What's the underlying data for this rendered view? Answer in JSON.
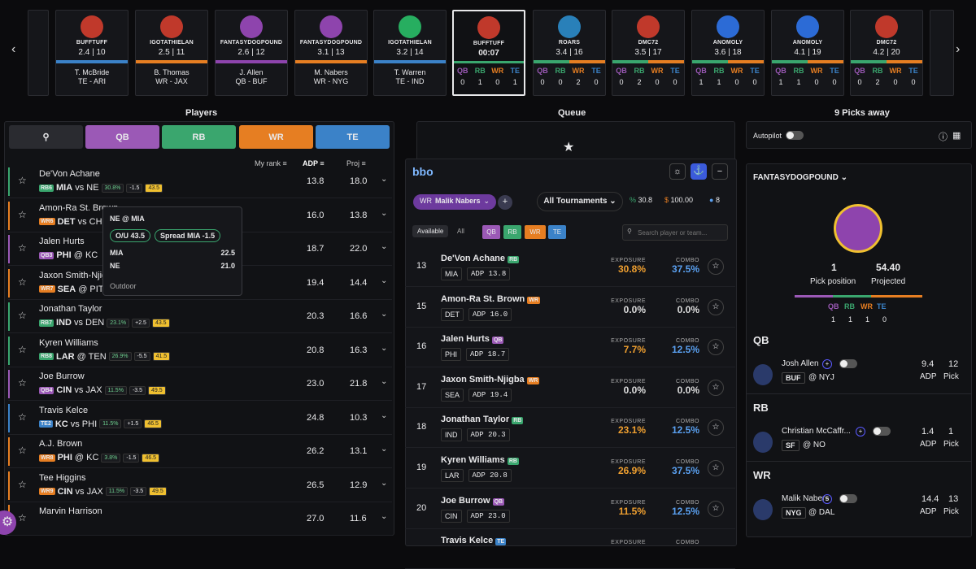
{
  "draft": {
    "cards": [
      {
        "name": "BUFFTUFF",
        "round": "2.4",
        "pick": "10",
        "player": "T. McBride",
        "team": "TE - ARI",
        "stripe": "#3b82c8",
        "av": "#c0392b"
      },
      {
        "name": "IGOTATHIELAN",
        "round": "2.5",
        "pick": "11",
        "player": "B. Thomas",
        "team": "WR - JAX",
        "stripe": "#e67e22",
        "av": "#c0392b"
      },
      {
        "name": "FANTASYDOGPOUND",
        "round": "2.6",
        "pick": "12",
        "player": "J. Allen",
        "team": "QB - BUF",
        "stripe": "#8e44ad",
        "av": "#8e44ad"
      },
      {
        "name": "FANTASYDOGPOUND",
        "round": "3.1",
        "pick": "13",
        "player": "M. Nabers",
        "team": "WR - NYG",
        "stripe": "#e67e22",
        "av": "#8e44ad"
      },
      {
        "name": "IGOTATHIELAN",
        "round": "3.2",
        "pick": "14",
        "player": "T. Warren",
        "team": "TE - IND",
        "stripe": "#3b82c8",
        "av": "#27ae60"
      }
    ],
    "current": {
      "name": "BUFFTUFF",
      "timer": "00:07",
      "counts": [
        "0",
        "1",
        "0",
        "1"
      ]
    },
    "future": [
      {
        "name": "ROARS",
        "round": "3.4",
        "pick": "16",
        "counts": [
          "0",
          "0",
          "2",
          "0"
        ],
        "av": "#2980b9"
      },
      {
        "name": "DMC72",
        "round": "3.5",
        "pick": "17",
        "counts": [
          "0",
          "2",
          "0",
          "0"
        ],
        "av": "#c0392b"
      },
      {
        "name": "ANOMOLY",
        "round": "3.6",
        "pick": "18",
        "counts": [
          "1",
          "1",
          "0",
          "0"
        ],
        "av": "#2c6bd6"
      },
      {
        "name": "ANOMOLY",
        "round": "4.1",
        "pick": "19",
        "counts": [
          "1",
          "1",
          "0",
          "0"
        ],
        "av": "#2c6bd6"
      },
      {
        "name": "DMC72",
        "round": "4.2",
        "pick": "20",
        "counts": [
          "0",
          "2",
          "0",
          "0"
        ],
        "av": "#c0392b"
      }
    ],
    "pos_labels": [
      "QB",
      "RB",
      "WR",
      "TE"
    ]
  },
  "sections": {
    "players": "Players",
    "queue": "Queue",
    "picks_away": "9 Picks away"
  },
  "player_tabs": {
    "qb": "QB",
    "rb": "RB",
    "wr": "WR",
    "te": "TE"
  },
  "columns": {
    "my_rank": "My rank",
    "adp": "ADP",
    "proj": "Proj"
  },
  "players": [
    {
      "name": "De'Von Achane",
      "pos": "RB6",
      "posc": "#3aa66e",
      "team": "MIA",
      "opp": "vs NE",
      "pct": "30.8%",
      "sp": "-1.5",
      "ou": "43.5",
      "adp": "13.8",
      "proj": "18.0"
    },
    {
      "name": "Amon-Ra St. Brown",
      "pos": "WR6",
      "posc": "#e67e22",
      "team": "DET",
      "opp": "vs CHI",
      "pct": "",
      "sp": "",
      "ou": "",
      "adp": "16.0",
      "proj": "13.8"
    },
    {
      "name": "Jalen Hurts",
      "pos": "QB3",
      "posc": "#9b59b6",
      "team": "PHI",
      "opp": "@ KC",
      "pct": "",
      "sp": "",
      "ou": "",
      "adp": "18.7",
      "proj": "22.0"
    },
    {
      "name": "Jaxon Smith-Njigba",
      "pos": "WR7",
      "posc": "#e67e22",
      "team": "SEA",
      "opp": "@ PIT",
      "pct": "",
      "sp": "",
      "ou": "",
      "adp": "19.4",
      "proj": "14.4"
    },
    {
      "name": "Jonathan Taylor",
      "pos": "RB7",
      "posc": "#3aa66e",
      "team": "IND",
      "opp": "vs DEN",
      "pct": "23.1%",
      "sp": "+2.5",
      "ou": "43.5",
      "adp": "20.3",
      "proj": "16.6"
    },
    {
      "name": "Kyren Williams",
      "pos": "RB8",
      "posc": "#3aa66e",
      "team": "LAR",
      "opp": "@ TEN",
      "pct": "26.9%",
      "sp": "-5.5",
      "ou": "41.5",
      "adp": "20.8",
      "proj": "16.3"
    },
    {
      "name": "Joe Burrow",
      "pos": "QB4",
      "posc": "#9b59b6",
      "team": "CIN",
      "opp": "vs JAX",
      "pct": "11.5%",
      "sp": "-3.5",
      "ou": "49.5",
      "adp": "23.0",
      "proj": "21.8"
    },
    {
      "name": "Travis Kelce",
      "pos": "TE2",
      "posc": "#3b82c8",
      "team": "KC",
      "opp": "vs PHI",
      "pct": "11.5%",
      "sp": "+1.5",
      "ou": "46.5",
      "adp": "24.8",
      "proj": "10.3"
    },
    {
      "name": "A.J. Brown",
      "pos": "WR8",
      "posc": "#e67e22",
      "team": "PHI",
      "opp": "@ KC",
      "pct": "3.8%",
      "sp": "-1.5",
      "ou": "46.5",
      "adp": "26.2",
      "proj": "13.1"
    },
    {
      "name": "Tee Higgins",
      "pos": "WR9",
      "posc": "#e67e22",
      "team": "CIN",
      "opp": "vs JAX",
      "pct": "11.5%",
      "sp": "-3.5",
      "ou": "49.5",
      "adp": "26.5",
      "proj": "12.9"
    },
    {
      "name": "Marvin Harrison",
      "pos": "",
      "posc": "#e67e22",
      "team": "",
      "opp": "",
      "pct": "",
      "sp": "",
      "ou": "",
      "adp": "27.0",
      "proj": "11.6"
    }
  ],
  "popup": {
    "title": "NE @ MIA",
    "ou": "O/U 43.5",
    "spread": "Spread MIA -1.5",
    "t1": "MIA",
    "s1": "22.5",
    "t2": "NE",
    "s2": "21.0",
    "weather": "Outdoor"
  },
  "bbo": {
    "logo": "bbo",
    "chip": "Malik Nabers",
    "chip_pos": "WR",
    "tournaments": "All Tournaments",
    "pct": "30.8",
    "dollars": "100.00",
    "users": "8",
    "filter_available": "Available",
    "filter_all": "All",
    "search_placeholder": "Search player or team...",
    "exposure_label": "EXPOSURE",
    "combo_label": "COMBO",
    "adp_label": "ADP",
    "rows": [
      {
        "rank": "13",
        "name": "De'Von Achane",
        "pos": "RB",
        "posc": "#3aa66e",
        "team": "MIA",
        "adp": "13.8",
        "exp": "30.8%",
        "expc": "#f0a030",
        "combo": "37.5%",
        "comboc": "#5aa0f0"
      },
      {
        "rank": "15",
        "name": "Amon-Ra St. Brown",
        "pos": "WR",
        "posc": "#e67e22",
        "team": "DET",
        "adp": "16.0",
        "exp": "0.0%",
        "expc": "#ddd",
        "combo": "0.0%",
        "comboc": "#ddd"
      },
      {
        "rank": "16",
        "name": "Jalen Hurts",
        "pos": "QB",
        "posc": "#9b59b6",
        "team": "PHI",
        "adp": "18.7",
        "exp": "7.7%",
        "expc": "#f0a030",
        "combo": "12.5%",
        "comboc": "#5aa0f0"
      },
      {
        "rank": "17",
        "name": "Jaxon Smith-Njigba",
        "pos": "WR",
        "posc": "#e67e22",
        "team": "SEA",
        "adp": "19.4",
        "exp": "0.0%",
        "expc": "#ddd",
        "combo": "0.0%",
        "comboc": "#ddd"
      },
      {
        "rank": "18",
        "name": "Jonathan Taylor",
        "pos": "RB",
        "posc": "#3aa66e",
        "team": "IND",
        "adp": "20.3",
        "exp": "23.1%",
        "expc": "#f0a030",
        "combo": "12.5%",
        "comboc": "#5aa0f0"
      },
      {
        "rank": "19",
        "name": "Kyren Williams",
        "pos": "RB",
        "posc": "#3aa66e",
        "team": "LAR",
        "adp": "20.8",
        "exp": "26.9%",
        "expc": "#f0a030",
        "combo": "37.5%",
        "comboc": "#5aa0f0"
      },
      {
        "rank": "20",
        "name": "Joe Burrow",
        "pos": "QB",
        "posc": "#9b59b6",
        "team": "CIN",
        "adp": "23.0",
        "exp": "11.5%",
        "expc": "#f0a030",
        "combo": "12.5%",
        "comboc": "#5aa0f0"
      },
      {
        "rank": "",
        "name": "Travis Kelce",
        "pos": "TE",
        "posc": "#3b82c8",
        "team": "",
        "adp": "",
        "exp": "",
        "expc": "#ddd",
        "combo": "",
        "comboc": "#ddd"
      }
    ]
  },
  "right": {
    "autopilot": "Autopilot",
    "team": "FANTASYDOGPOUND",
    "pick_pos": "1",
    "pick_pos_label": "Pick position",
    "projected": "54.40",
    "projected_label": "Projected",
    "counts": [
      "1",
      "1",
      "1",
      "0"
    ],
    "groups": [
      {
        "title": "QB",
        "name": "Josh Allen",
        "team": "BUF",
        "opp": "@ NYJ",
        "adp": "9.4",
        "pick": "12"
      },
      {
        "title": "RB",
        "name": "Christian McCaffr...",
        "team": "SF",
        "opp": "@ NO",
        "adp": "1.4",
        "pick": "1"
      },
      {
        "title": "WR",
        "name": "Malik Nabers",
        "team": "NYG",
        "opp": "@ DAL",
        "adp": "14.4",
        "pick": "13"
      }
    ],
    "adp_label": "ADP",
    "pick_label": "Pick"
  }
}
